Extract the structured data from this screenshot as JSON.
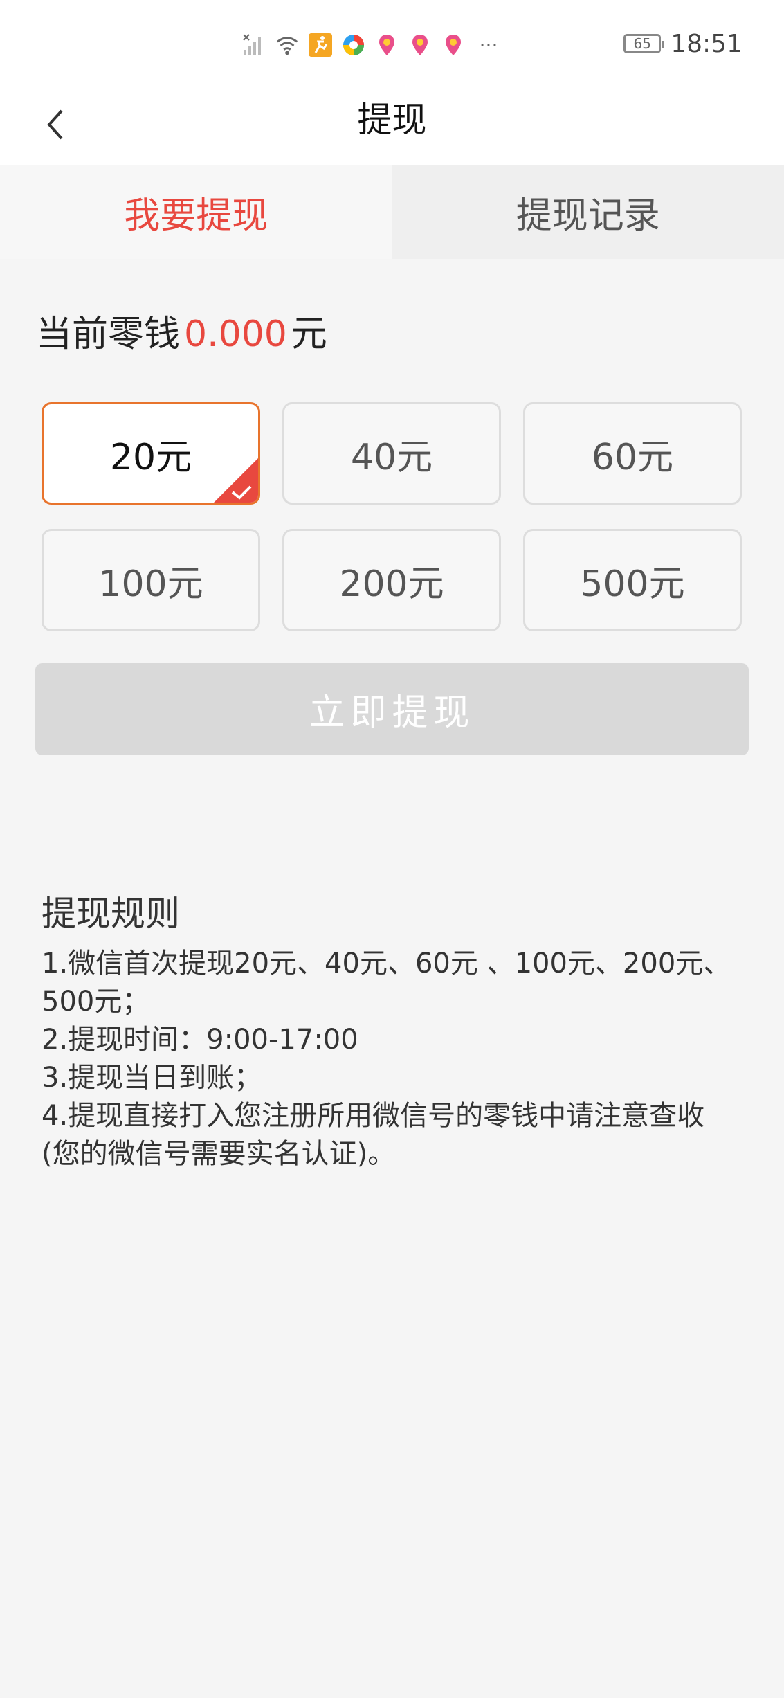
{
  "status_bar": {
    "time": "18:51",
    "battery": "65",
    "more": "···"
  },
  "header": {
    "title": "提现"
  },
  "tabs": [
    {
      "label": "我要提现",
      "active": true
    },
    {
      "label": "提现记录",
      "active": false
    }
  ],
  "balance": {
    "label": "当前零钱",
    "amount": "0.000",
    "unit": "元"
  },
  "options": [
    {
      "label": "20元",
      "selected": true
    },
    {
      "label": "40元",
      "selected": false
    },
    {
      "label": "60元",
      "selected": false
    },
    {
      "label": "100元",
      "selected": false
    },
    {
      "label": "200元",
      "selected": false
    },
    {
      "label": "500元",
      "selected": false
    }
  ],
  "submit_label": "立即提现",
  "rules": {
    "title": "提现规则",
    "items": [
      "1.微信首次提现20元、40元、60元 、100元、200元、500元；",
      "2.提现时间：9:00-17:00",
      "3.提现当日到账；",
      "4.提现直接打入您注册所用微信号的零钱中请注意查收(您的微信号需要实名认证)。"
    ]
  },
  "colors": {
    "accent_red": "#e8483f",
    "selected_border": "#e8742d",
    "button_disabled": "#d9d9d9"
  }
}
